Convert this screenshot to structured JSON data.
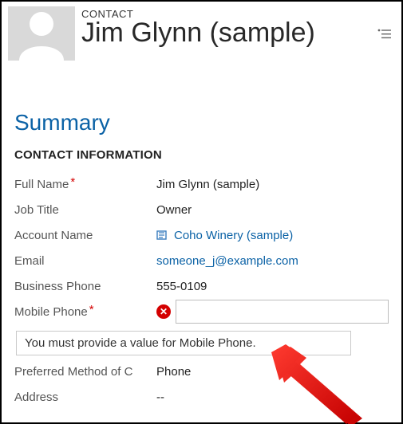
{
  "header": {
    "entity_label": "CONTACT",
    "record_name": "Jim Glynn (sample)"
  },
  "summary": {
    "tab_title": "Summary",
    "section_label": "CONTACT INFORMATION"
  },
  "fields": {
    "full_name": {
      "label": "Full Name",
      "value": "Jim Glynn (sample)",
      "required": true
    },
    "job_title": {
      "label": "Job Title",
      "value": "Owner"
    },
    "account": {
      "label": "Account Name",
      "value": "Coho Winery (sample)"
    },
    "email": {
      "label": "Email",
      "value": "someone_j@example.com"
    },
    "bus_phone": {
      "label": "Business Phone",
      "value": "555-0109"
    },
    "mobile": {
      "label": "Mobile Phone",
      "value": "",
      "required": true,
      "error": true
    },
    "pref_method": {
      "label": "Preferred Method of Contact",
      "label_truncated": "Preferred Method of C",
      "value": "Phone"
    },
    "address": {
      "label": "Address",
      "value": "--"
    }
  },
  "validation": {
    "mobile_error": "You must provide a value for Mobile Phone."
  }
}
